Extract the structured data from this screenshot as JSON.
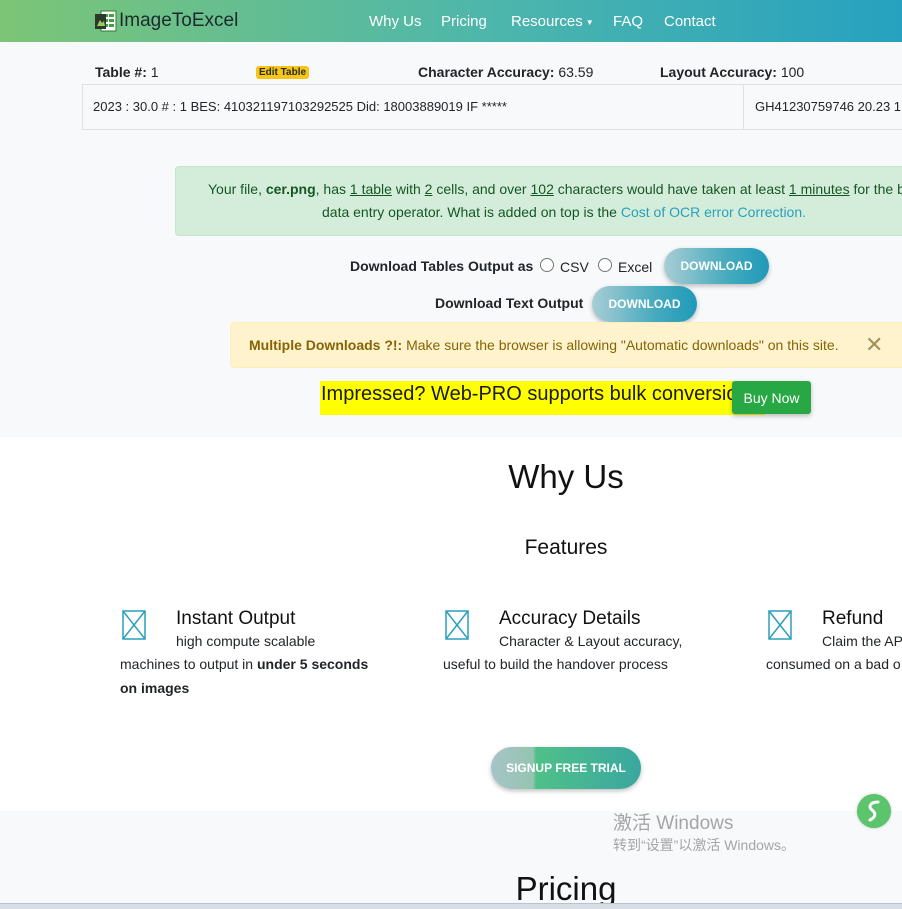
{
  "nav": {
    "brand": "ImageToExcel",
    "items": [
      "Why Us",
      "Pricing",
      "Resources",
      "FAQ",
      "Contact"
    ],
    "dropdown_item_index": 2
  },
  "table_header": {
    "table_label": "Table #:",
    "table_number": "1",
    "edit_button": "Edit Table",
    "char_acc_label": "Character Accuracy:",
    "char_acc_value": "63.59",
    "layout_acc_label": "Layout Accuracy:",
    "layout_acc_value": "100"
  },
  "table_cells": [
    "2023 : 30.0 # : 1 BES: 410321197103292525 Did: 18003889019 IF *****",
    "GH41230759746 20.23 1"
  ],
  "file_alert": {
    "p1": "Your file, ",
    "filename": "cer.png",
    "p2": ", has ",
    "tables": "1 table",
    "p3": " with ",
    "cells": "2",
    "p4": " cells, and over ",
    "chars": "102",
    "p5": " characters would have taken at least ",
    "minutes": "1 minutes",
    "p6": " for the b",
    "line2": "data entry operator. What is added on top is the ",
    "link": "Cost of OCR error Correction."
  },
  "downloads": {
    "tables_label": "Download Tables Output as",
    "csv": "CSV",
    "excel": "Excel",
    "btn": "DOWNLOAD",
    "text_label": "Download Text Output",
    "btn2": "DOWNLOAD"
  },
  "multi_alert": {
    "bold": "Multiple Downloads ?!:",
    "text": " Make sure the browser is allowing \"Automatic downloads\" on this site.",
    "close": "✕"
  },
  "promo": {
    "text": "Impressed? Web-PRO supports bulk conversions.",
    "button": "Buy Now"
  },
  "why_us": {
    "title": "Why Us",
    "features_title": "Features",
    "features": [
      {
        "title": "Instant Output",
        "line1": "high compute scalable",
        "line2_a": "machines to output in ",
        "line2_b": "under 5 seconds",
        "line3": "on images"
      },
      {
        "title": "Accuracy Details",
        "line1": "Character & Layout accuracy,",
        "line2": "useful to build the handover process"
      },
      {
        "title": "Refund",
        "line1": "Claim the AP",
        "line2": "consumed on a bad o"
      }
    ],
    "signup": "SIGNUP FREE TRIAL"
  },
  "pricing_title": "Pricing",
  "windows_watermark": {
    "line1": "激活 Windows",
    "line2": "转到“设置”以激活 Windows。"
  },
  "colors": {
    "nav_gradient_start": "#7cc576",
    "nav_gradient_end": "#26a1c0",
    "success": "#28a745",
    "promo_highlight": "#ffff00",
    "alert_green_bg": "#d4edda",
    "alert_yellow_bg": "#fff3cd"
  }
}
